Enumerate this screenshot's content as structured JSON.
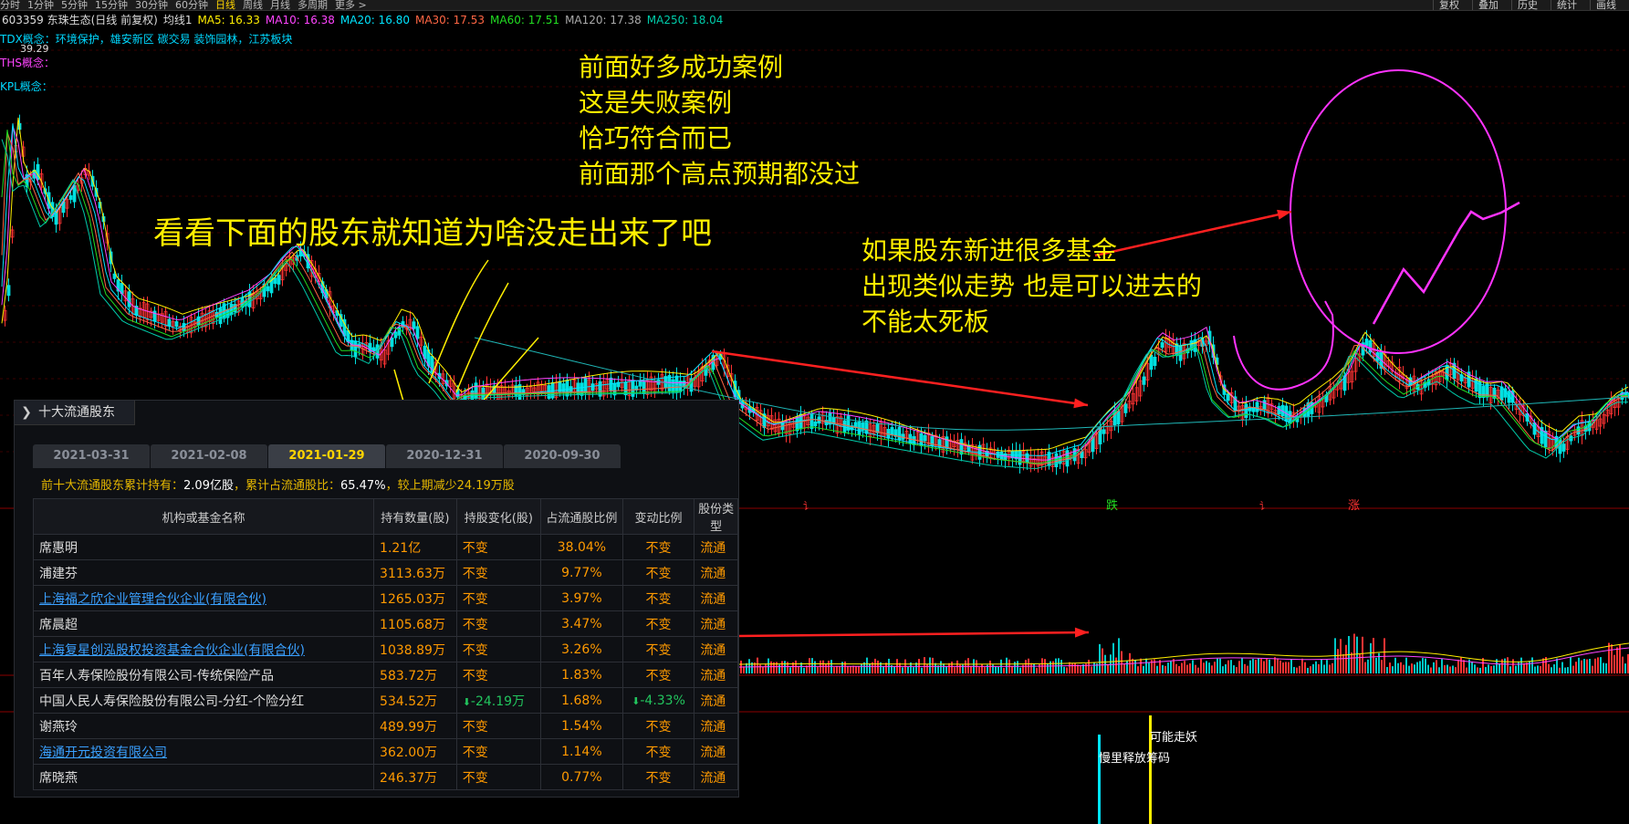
{
  "toolbar": {
    "periods": [
      "分时",
      "1分钟",
      "5分钟",
      "15分钟",
      "30分钟",
      "60分钟",
      "日线",
      "周线",
      "月线",
      "多周期",
      "更多 >"
    ],
    "active_period": "日线",
    "right_buttons": [
      "复权",
      "叠加",
      "历史",
      "统计",
      "画线"
    ]
  },
  "quote": {
    "stock": "603359 东珠生态(日线 前复权)",
    "ma_group": "均线1",
    "ma": [
      {
        "label": "MA5: 16.33",
        "color": "#ffee00"
      },
      {
        "label": "MA10: 16.38",
        "color": "#ff44ff"
      },
      {
        "label": "MA20: 16.80",
        "color": "#00e5ff"
      },
      {
        "label": "MA30: 17.53",
        "color": "#ff6644"
      },
      {
        "label": "MA60: 17.51",
        "color": "#22dd22"
      },
      {
        "label": "MA120: 17.38",
        "color": "#aaaaaa"
      },
      {
        "label": "MA250: 18.04",
        "color": "#00ccaa"
      }
    ]
  },
  "concepts": {
    "tdx": "TDX概念：环境保护，雄安新区 碳交易 装饰园林，江苏板块",
    "ths": "THS概念：",
    "kpl": "KPL概念：",
    "high_price": "39.29"
  },
  "notes": {
    "n1": "前面好多成功案例",
    "n2": "这是失败案例",
    "n3": "恰巧符合而已",
    "n4": "前面那个高点预期都没过",
    "n5": "看看下面的股东就知道为啥没走出来了吧",
    "n6": "如果股东新进很多基金",
    "n7": "出现类似走势 也是可以进去的",
    "n8": "不能太死板"
  },
  "markers": {
    "die": "跌",
    "zhang": "涨",
    "mark_a": "讠",
    "mark_b": "讠",
    "kenengzouyao": "可能走妖",
    "bottom_label": "慢里释放筹码"
  },
  "panel": {
    "title": "十大流通股东",
    "tabs": [
      "2021-03-31",
      "2021-02-08",
      "2021-01-29",
      "2020-12-31",
      "2020-09-30"
    ],
    "active_tab": "2021-01-29",
    "summary_prefix": "前十大流通股东累计持有：",
    "summary_holdings": "2.09亿股",
    "summary_mid": "，累计占流通股比：",
    "summary_ratio": "65.47%",
    "summary_suffix": "，较上期减少24.19万股",
    "columns": [
      "机构或基金名称",
      "持有数量(股)",
      "持股变化(股)",
      "占流通股比例",
      "变动比例",
      "股份类型"
    ],
    "rows": [
      {
        "name": "席惠明",
        "qty": "1.21亿",
        "change": "不变",
        "pct": "38.04%",
        "ratio": "不变",
        "type": "流通",
        "link": false,
        "down": false
      },
      {
        "name": "浦建芬",
        "qty": "3113.63万",
        "change": "不变",
        "pct": "9.77%",
        "ratio": "不变",
        "type": "流通",
        "link": false,
        "down": false
      },
      {
        "name": "上海福之欣企业管理合伙企业(有限合伙)",
        "qty": "1265.03万",
        "change": "不变",
        "pct": "3.97%",
        "ratio": "不变",
        "type": "流通",
        "link": true,
        "down": false
      },
      {
        "name": "席晨超",
        "qty": "1105.68万",
        "change": "不变",
        "pct": "3.47%",
        "ratio": "不变",
        "type": "流通",
        "link": false,
        "down": false
      },
      {
        "name": "上海复星创泓股权投资基金合伙企业(有限合伙)",
        "qty": "1038.89万",
        "change": "不变",
        "pct": "3.26%",
        "ratio": "不变",
        "type": "流通",
        "link": true,
        "down": false
      },
      {
        "name": "百年人寿保险股份有限公司-传统保险产品",
        "qty": "583.72万",
        "change": "不变",
        "pct": "1.83%",
        "ratio": "不变",
        "type": "流通",
        "link": false,
        "down": false
      },
      {
        "name": "中国人民人寿保险股份有限公司-分红-个险分红",
        "qty": "534.52万",
        "change": "-24.19万",
        "pct": "1.68%",
        "ratio": "-4.33%",
        "type": "流通",
        "link": false,
        "down": true
      },
      {
        "name": "谢燕玲",
        "qty": "489.99万",
        "change": "不变",
        "pct": "1.54%",
        "ratio": "不变",
        "type": "流通",
        "link": false,
        "down": false
      },
      {
        "name": "海通开元投资有限公司",
        "qty": "362.00万",
        "change": "不变",
        "pct": "1.14%",
        "ratio": "不变",
        "type": "流通",
        "link": true,
        "down": false
      },
      {
        "name": "席晓燕",
        "qty": "246.37万",
        "change": "不变",
        "pct": "0.77%",
        "ratio": "不变",
        "type": "流通",
        "link": false,
        "down": false
      }
    ]
  },
  "colors": {
    "annotation": "#ffee00",
    "circle": "#ff33ff",
    "arrow": "#ff2020",
    "up": "#ff3333",
    "down": "#00e0e0"
  }
}
